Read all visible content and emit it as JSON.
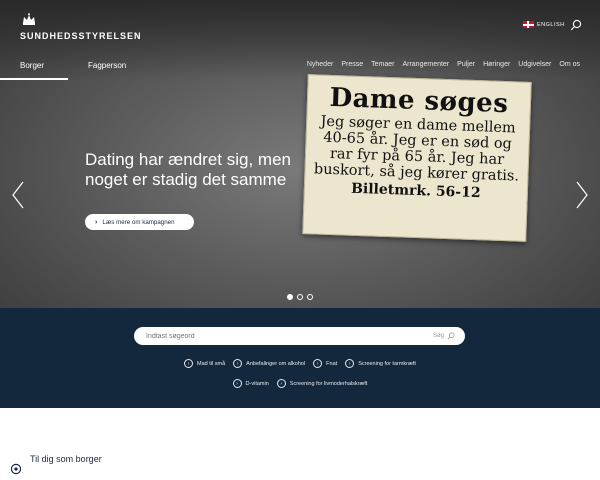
{
  "header": {
    "brand": "SUNDHEDSSTYRELSEN",
    "language_label": "ENGLISH"
  },
  "nav": {
    "audience_tabs": [
      {
        "label": "Borger",
        "active": true
      },
      {
        "label": "Fagperson",
        "active": false
      }
    ],
    "items": [
      "Nyheder",
      "Presse",
      "Temaer",
      "Arrangementer",
      "Puljer",
      "Høringer",
      "Udgivelser",
      "Om os"
    ]
  },
  "hero": {
    "headline_line1": "Dating har ændret sig, men",
    "headline_line2": "noget er stadig det samme",
    "cta_label": "Læs mere om kampagnen",
    "slide_count": 3,
    "active_slide": 1,
    "ad": {
      "title": "Dame søges",
      "body_lines": [
        "Jeg søger en dame mellem",
        "40-65 år. Jeg er en sød og",
        "rar fyr på 65 år. Jeg har",
        "buskort, så jeg kører gratis."
      ],
      "reference": "Billetmrk. 56-12"
    }
  },
  "search": {
    "placeholder": "Indtast søgeord",
    "button_label": "Søg",
    "quick_links_row1": [
      "Mad til små",
      "Anbefalinger om alkohol",
      "Fnat",
      "Screening for tarmkræft"
    ],
    "quick_links_row2": [
      "D-vitamin",
      "Screening for livmoderhalskræft"
    ]
  },
  "section": {
    "title": "Til dig som borger"
  },
  "colors": {
    "band": "#14283d",
    "hero": "#5c5c5c",
    "text_dark": "#1a2a44"
  }
}
